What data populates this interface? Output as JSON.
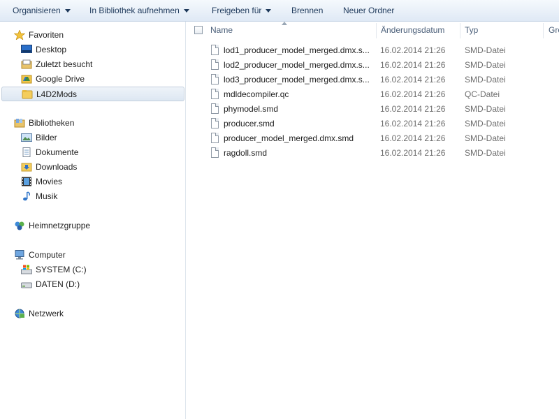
{
  "toolbar": {
    "organize": "Organisieren",
    "include_library": "In Bibliothek aufnehmen",
    "share": "Freigeben für",
    "burn": "Brennen",
    "new_folder": "Neuer Ordner"
  },
  "nav": {
    "favorites": {
      "label": "Favoriten",
      "items": [
        "Desktop",
        "Zuletzt besucht",
        "Google Drive",
        "L4D2Mods"
      ],
      "selected": "L4D2Mods"
    },
    "libraries": {
      "label": "Bibliotheken",
      "items": [
        "Bilder",
        "Dokumente",
        "Downloads",
        "Movies",
        "Musik"
      ]
    },
    "homegroup": {
      "label": "Heimnetzgruppe"
    },
    "computer": {
      "label": "Computer",
      "items": [
        "SYSTEM (C:)",
        "DATEN (D:)"
      ]
    },
    "network": {
      "label": "Netzwerk"
    }
  },
  "columns": {
    "name": "Name",
    "date": "Änderungsdatum",
    "type": "Typ",
    "size": "Grö"
  },
  "files": [
    {
      "name": "lod1_producer_model_merged.dmx.s...",
      "date": "16.02.2014 21:26",
      "type": "SMD-Datei"
    },
    {
      "name": "lod2_producer_model_merged.dmx.s...",
      "date": "16.02.2014 21:26",
      "type": "SMD-Datei"
    },
    {
      "name": "lod3_producer_model_merged.dmx.s...",
      "date": "16.02.2014 21:26",
      "type": "SMD-Datei"
    },
    {
      "name": "mdldecompiler.qc",
      "date": "16.02.2014 21:26",
      "type": "QC-Datei"
    },
    {
      "name": "phymodel.smd",
      "date": "16.02.2014 21:26",
      "type": "SMD-Datei"
    },
    {
      "name": "producer.smd",
      "date": "16.02.2014 21:26",
      "type": "SMD-Datei"
    },
    {
      "name": "producer_model_merged.dmx.smd",
      "date": "16.02.2014 21:26",
      "type": "SMD-Datei"
    },
    {
      "name": "ragdoll.smd",
      "date": "16.02.2014 21:26",
      "type": "SMD-Datei"
    }
  ]
}
